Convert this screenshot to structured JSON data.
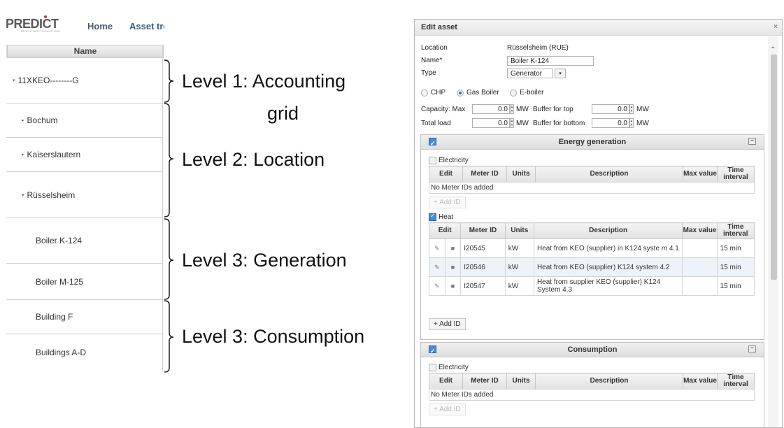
{
  "nav": {
    "logo": "PREDICT",
    "logo_sub": "INTELLIGENT SOLUTIONS",
    "home": "Home",
    "asset_tree": "Asset tre"
  },
  "tree": {
    "header": "Name",
    "rows": [
      {
        "label": "11XKEO--------G",
        "arrow": "▾"
      },
      {
        "label": "Bochum",
        "arrow": "▸"
      },
      {
        "label": "Kaiserslautern",
        "arrow": "▸"
      },
      {
        "label": "Rüsselsheim",
        "arrow": "▾"
      },
      {
        "label": "Boiler K-124",
        "arrow": ""
      },
      {
        "label": "Boiler M-125",
        "arrow": ""
      },
      {
        "label": "Building F",
        "arrow": ""
      },
      {
        "label": "Buildings A-D",
        "arrow": ""
      }
    ]
  },
  "annotations": {
    "level1_line1": "Level 1: Accounting",
    "level1_line2": "grid",
    "level2": "Level 2: Location",
    "level3_gen": "Level 3: Generation",
    "level3_con": "Level 3: Consumption"
  },
  "dialog": {
    "title": "Edit asset",
    "close": "×",
    "location_label": "Location",
    "location_value": "Rüsselsheim (RUE)",
    "name_label": "Name*",
    "name_value": "Boiler K-124",
    "type_label": "Type",
    "type_value": "Generator",
    "radios": [
      "CHP",
      "Gas Boiler",
      "E-boiler"
    ],
    "radio_selected": "Gas Boiler",
    "capacity_label": "Capacity: Max",
    "capacity_value": "0.0",
    "unit_mw": "MW",
    "buffer_top_label": "Buffer for top",
    "buffer_top_value": "0.0",
    "total_load_label": "Total load",
    "total_load_value": "0.0",
    "buffer_bottom_label": "Buffer for bottom",
    "buffer_bottom_value": "0.0",
    "headers": {
      "edit": "Edit",
      "meter_id": "Meter ID",
      "units": "Units",
      "description": "Description",
      "max_value": "Max value",
      "time_interval": "Time interval"
    },
    "energy_generation": {
      "title": "Energy generation",
      "electricity_label": "Electricity",
      "electricity_checked": false,
      "electricity_empty": "No Meter IDs added",
      "electricity_add": "+ Add ID",
      "heat_label": "Heat",
      "heat_checked": true,
      "heat_add": "+ Add ID",
      "heat_rows": [
        {
          "meter": "I20545",
          "units": "kW",
          "description": "Heat from KEO (supplier) in K124 syste m 4.1",
          "max": "",
          "interval": "15 min"
        },
        {
          "meter": "I20546",
          "units": "kW",
          "description": "Heat from KEO (supplier) K124 system 4.2",
          "max": "",
          "interval": "15 min"
        },
        {
          "meter": "I20547",
          "units": "kW",
          "description": "Heat from supplier KEO (supplier) K124 System 4.3",
          "max": "",
          "interval": "15 min"
        }
      ]
    },
    "consumption": {
      "title": "Consumption",
      "electricity_label": "Electricity",
      "electricity_empty": "No Meter IDs added",
      "electricity_add": "+ Add ID"
    }
  }
}
